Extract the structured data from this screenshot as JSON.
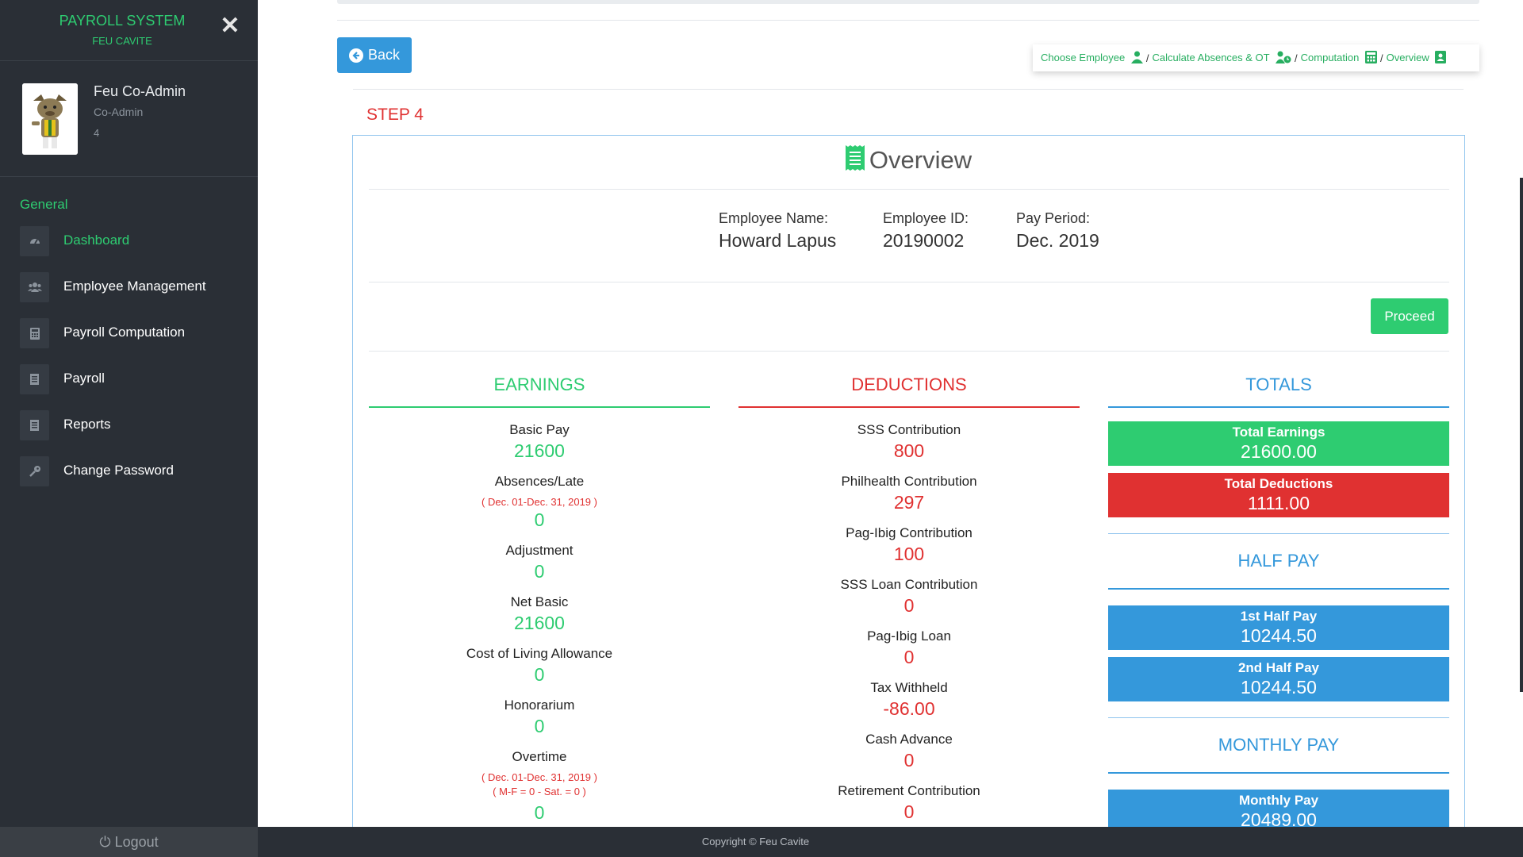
{
  "sidebar": {
    "brand_title": "PAYROLL SYSTEM",
    "brand_sub": "FEU CAVITE",
    "profile": {
      "name": "Feu Co-Admin",
      "role": "Co-Admin",
      "id": "4"
    },
    "section": "General",
    "items": [
      {
        "label": "Dashboard",
        "icon": "dashboard-icon"
      },
      {
        "label": "Employee Management",
        "icon": "users-icon"
      },
      {
        "label": "Payroll Computation",
        "icon": "calculator-icon"
      },
      {
        "label": "Payroll",
        "icon": "document-icon"
      },
      {
        "label": "Reports",
        "icon": "report-icon"
      },
      {
        "label": "Change Password",
        "icon": "key-icon"
      }
    ],
    "logout": "Logout"
  },
  "toolbar": {
    "back_label": "Back"
  },
  "breadcrumb": [
    "Choose Employee",
    "Calculate Absences & OT",
    "Computation",
    "Overview"
  ],
  "step": "STEP 4",
  "overview": {
    "title": "Overview",
    "employee_name_label": "Employee Name:",
    "employee_name": "Howard Lapus",
    "employee_id_label": "Employee ID:",
    "employee_id": "20190002",
    "pay_period_label": "Pay Period:",
    "pay_period": "Dec. 2019",
    "proceed_label": "Proceed"
  },
  "earnings": {
    "heading": "EARNINGS",
    "items": [
      {
        "name": "Basic Pay",
        "value": "21600"
      },
      {
        "name": "Absences/Late",
        "note": "( Dec. 01-Dec. 31, 2019 )",
        "value": "0"
      },
      {
        "name": "Adjustment",
        "value": "0"
      },
      {
        "name": "Net Basic",
        "value": "21600"
      },
      {
        "name": "Cost of Living Allowance",
        "value": "0"
      },
      {
        "name": "Honorarium",
        "value": "0"
      },
      {
        "name": "Overtime",
        "note": "( Dec. 01-Dec. 31, 2019 )",
        "note2": "( M-F = 0 - Sat. = 0 )",
        "value": "0"
      }
    ]
  },
  "deductions": {
    "heading": "DEDUCTIONS",
    "items": [
      {
        "name": "SSS Contribution",
        "value": "800"
      },
      {
        "name": "Philhealth Contribution",
        "value": "297"
      },
      {
        "name": "Pag-Ibig Contribution",
        "value": "100"
      },
      {
        "name": "SSS Loan Contribution",
        "value": "0"
      },
      {
        "name": "Pag-Ibig Loan",
        "value": "0"
      },
      {
        "name": "Tax Withheld",
        "value": "-86.00"
      },
      {
        "name": "Cash Advance",
        "value": "0"
      },
      {
        "name": "Retirement Contribution",
        "value": "0"
      }
    ]
  },
  "totals": {
    "heading": "TOTALS",
    "total_earnings_label": "Total Earnings",
    "total_earnings": "21600.00",
    "total_deductions_label": "Total Deductions",
    "total_deductions": "1111.00",
    "half_pay_heading": "HALF PAY",
    "first_half_label": "1st Half Pay",
    "first_half": "10244.50",
    "second_half_label": "2nd Half Pay",
    "second_half": "10244.50",
    "monthly_heading": "MONTHLY PAY",
    "monthly_label": "Monthly Pay",
    "monthly": "20489.00"
  },
  "footer": "Copyright © Feu Cavite",
  "colors": {
    "sidebar": "#2a2f36",
    "accent_green": "#2ecc71",
    "accent_red": "#e03131",
    "accent_blue": "#3498db"
  }
}
